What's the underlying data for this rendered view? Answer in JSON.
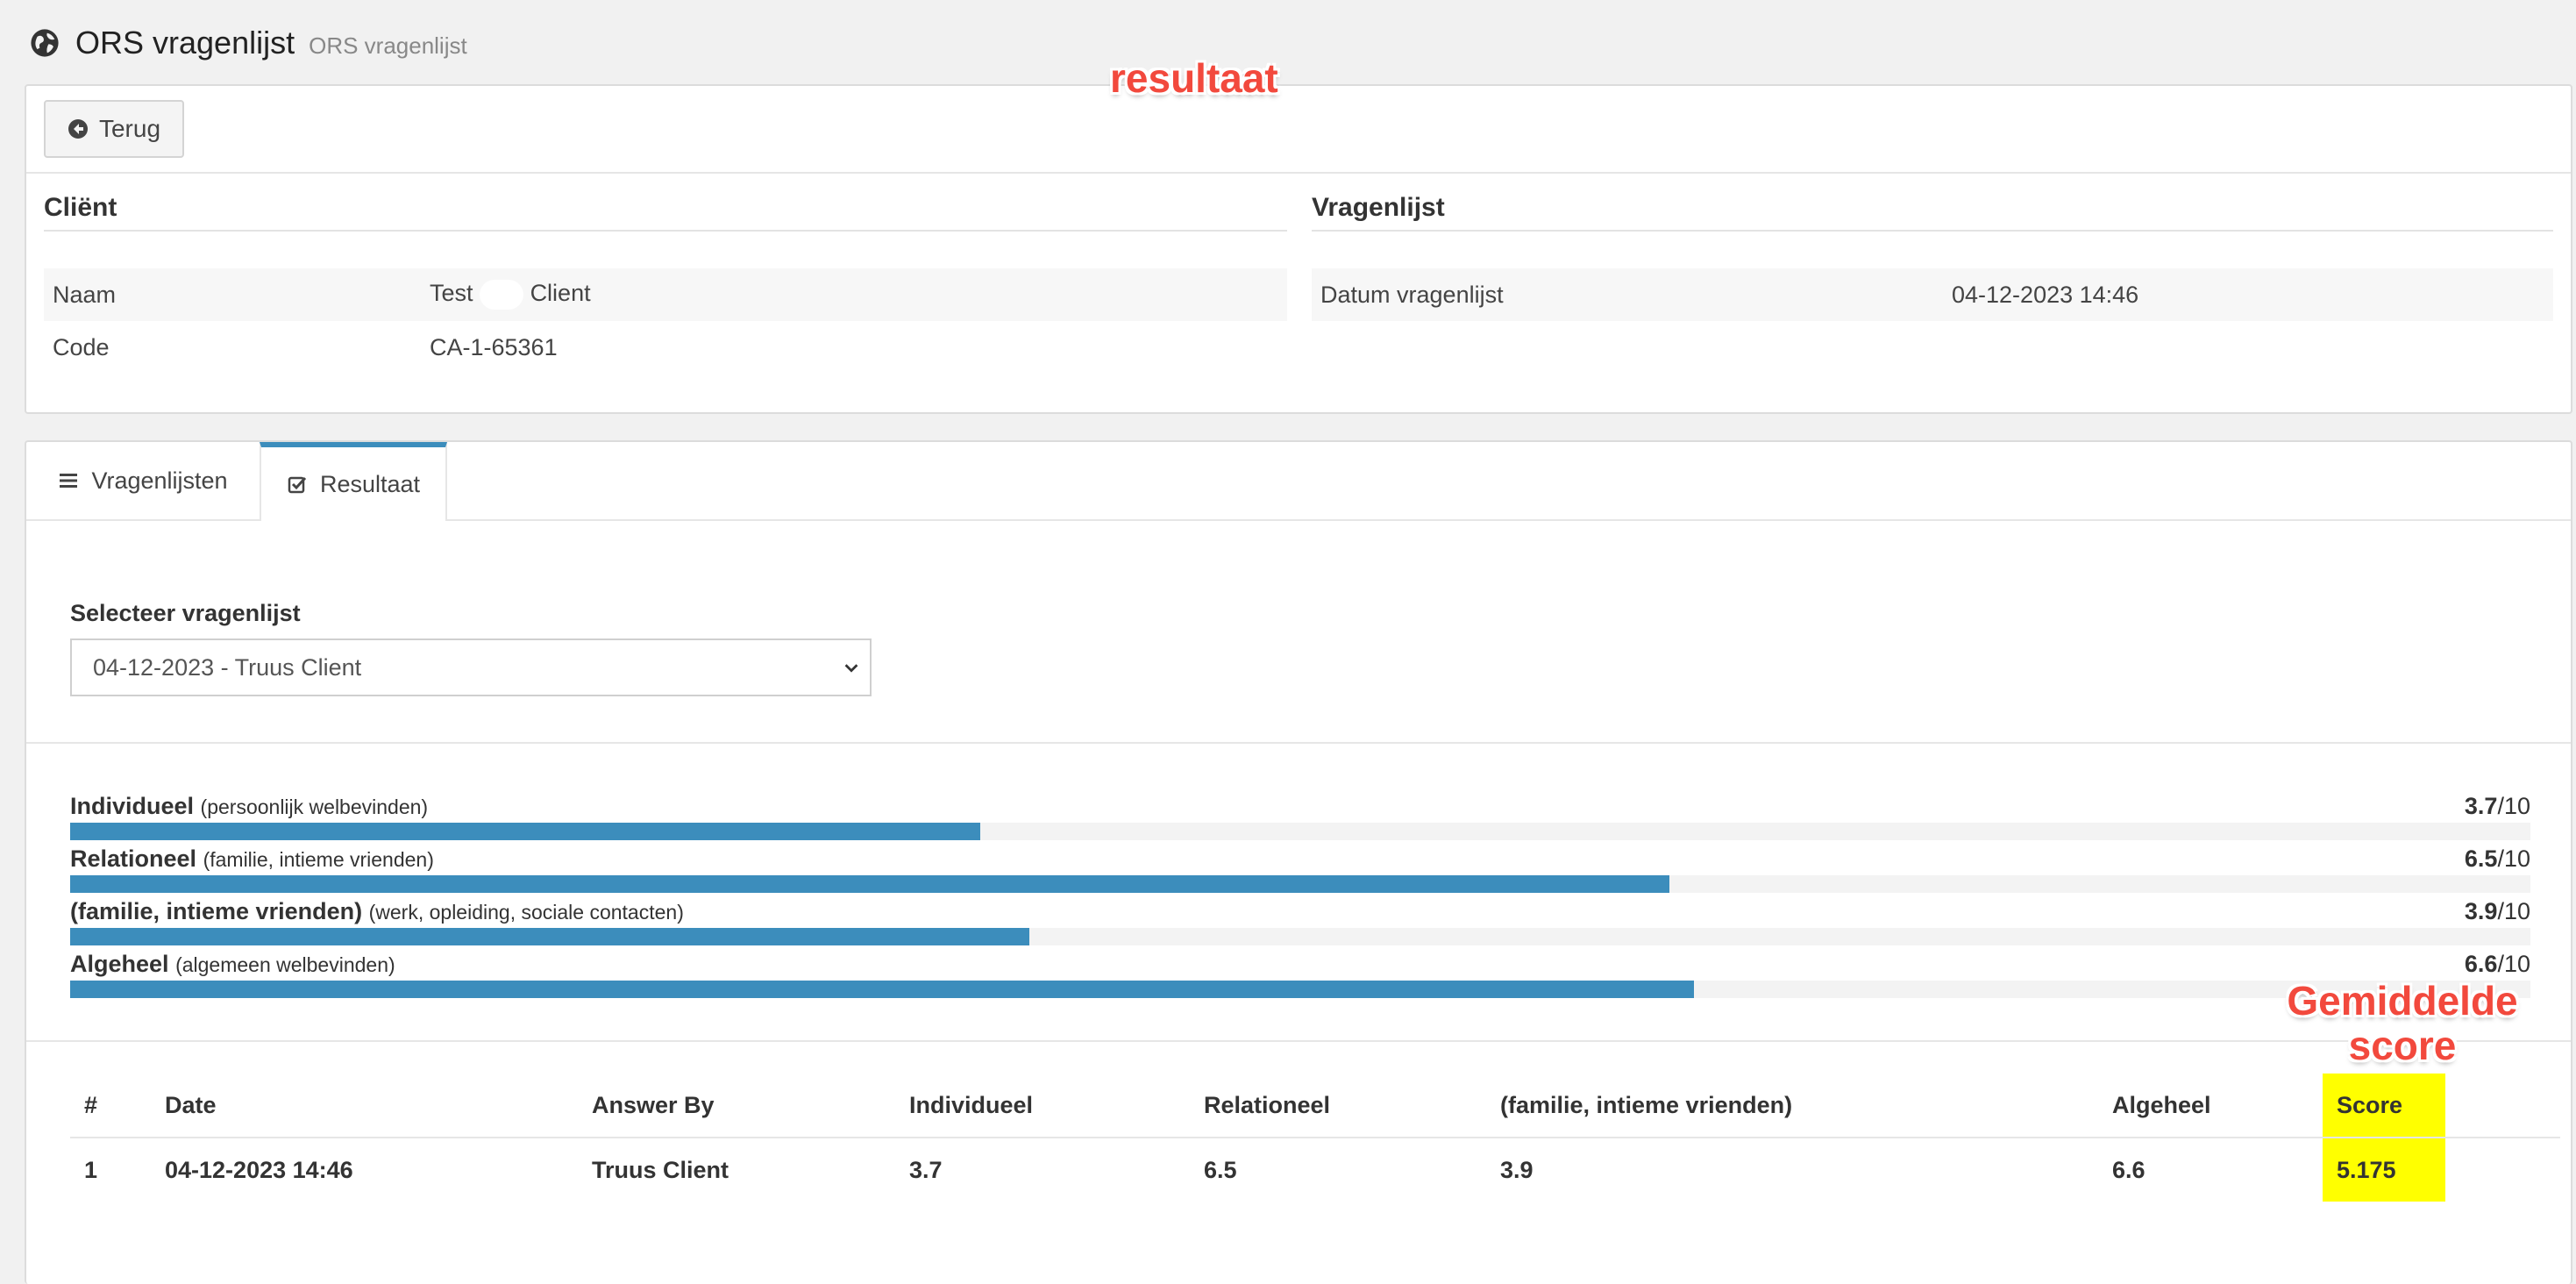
{
  "header": {
    "title": "ORS vragenlijst",
    "subtitle": "ORS vragenlijst"
  },
  "annotations": {
    "top": "resultaat",
    "score_note": "Gemiddelde score"
  },
  "toolbar": {
    "back_label": "Terug"
  },
  "client": {
    "title": "Cliënt",
    "rows": [
      {
        "label": "Naam",
        "value_first": "Test",
        "value_last": "Client"
      },
      {
        "label": "Code",
        "value": "CA-1-65361"
      }
    ]
  },
  "questionnaire": {
    "title": "Vragenlijst",
    "rows": [
      {
        "label": "Datum vragenlijst",
        "value": "04-12-2023 14:46"
      }
    ]
  },
  "tabs": [
    {
      "label": "Vragenlijsten"
    },
    {
      "label": "Resultaat",
      "active": true
    }
  ],
  "select": {
    "label": "Selecteer vragenlijst",
    "value": "04-12-2023 - Truus Client"
  },
  "bars": [
    {
      "label": "Individueel",
      "sub": "(persoonlijk welbevinden)",
      "score": "3.7",
      "max": "/10",
      "value": 3.7
    },
    {
      "label": "Relationeel",
      "sub": "(familie, intieme vrienden)",
      "score": "6.5",
      "max": "/10",
      "value": 6.5
    },
    {
      "label": "(familie, intieme vrienden)",
      "sub": "(werk, opleiding, sociale contacten)",
      "score": "3.9",
      "max": "/10",
      "value": 3.9
    },
    {
      "label": "Algeheel",
      "sub": "(algemeen welbevinden)",
      "score": "6.6",
      "max": "/10",
      "value": 6.6
    }
  ],
  "table": {
    "headers": [
      "#",
      "Date",
      "Answer By",
      "Individueel",
      "Relationeel",
      "(familie, intieme vrienden)",
      "Algeheel",
      "Score"
    ],
    "rows": [
      [
        "1",
        "04-12-2023 14:46",
        "Truus Client",
        "3.7",
        "6.5",
        "3.9",
        "6.6",
        "5.175"
      ]
    ]
  },
  "colors": {
    "accent": "#3c8dbc",
    "highlight": "#ffff00",
    "annotation": "#f2493d"
  }
}
